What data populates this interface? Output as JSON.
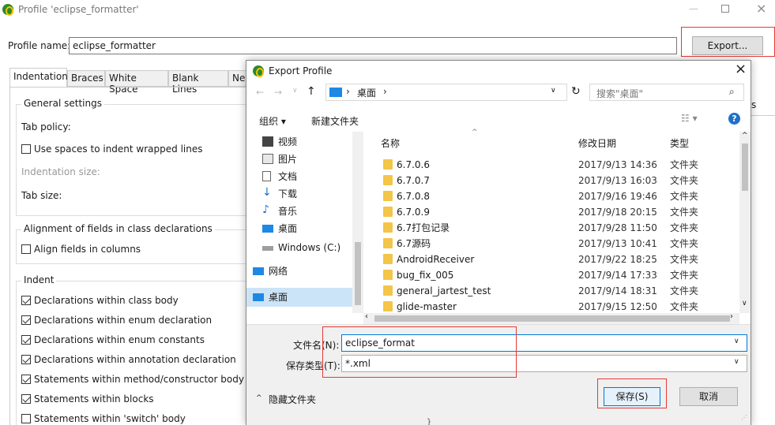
{
  "main_window": {
    "title": "Profile 'eclipse_formatter'",
    "profile_name_label": "Profile name:",
    "profile_name_value": "eclipse_formatter",
    "export_button": "Export...",
    "tabs": [
      "Indentation",
      "Braces",
      "White Space",
      "Blank Lines",
      "Ne"
    ],
    "right_edge_letter": "s",
    "preview_fragment": "}"
  },
  "groups": {
    "general": {
      "title": "General settings",
      "tab_policy": "Tab policy:",
      "use_spaces": "Use spaces to indent wrapped lines",
      "indentation_size": "Indentation size:",
      "tab_size": "Tab size:"
    },
    "alignment": {
      "title": "Alignment of fields in class declarations",
      "align_fields": "Align fields in columns"
    },
    "indent": {
      "title": "Indent",
      "items": [
        {
          "label": "Declarations within class body",
          "checked": true
        },
        {
          "label": "Declarations within enum declaration",
          "checked": true
        },
        {
          "label": "Declarations within enum constants",
          "checked": true
        },
        {
          "label": "Declarations within annotation declaration",
          "checked": true
        },
        {
          "label": "Statements within method/constructor body",
          "checked": true
        },
        {
          "label": "Statements within blocks",
          "checked": true
        },
        {
          "label": "Statements within 'switch' body",
          "checked": false
        }
      ]
    }
  },
  "dialog": {
    "title": "Export Profile",
    "close": "×",
    "path_current": "桌面",
    "path_sep": "›",
    "search_placeholder": "搜索\"桌面\"",
    "organize": "组织 ▾",
    "new_folder": "新建文件夹",
    "nav": [
      "视频",
      "图片",
      "文档",
      "下载",
      "音乐",
      "桌面",
      "Windows (C:)",
      "网络",
      "桌面"
    ],
    "columns": {
      "name": "名称",
      "date": "修改日期",
      "type": "类型"
    },
    "files": [
      {
        "name": "6.7.0.6",
        "date": "2017/9/13 14:36",
        "type": "文件夹"
      },
      {
        "name": "6.7.0.7",
        "date": "2017/9/13 16:03",
        "type": "文件夹"
      },
      {
        "name": "6.7.0.8",
        "date": "2017/9/16 19:46",
        "type": "文件夹"
      },
      {
        "name": "6.7.0.9",
        "date": "2017/9/18 20:15",
        "type": "文件夹"
      },
      {
        "name": "6.7打包记录",
        "date": "2017/9/28 11:50",
        "type": "文件夹"
      },
      {
        "name": "6.7源码",
        "date": "2017/9/13 10:41",
        "type": "文件夹"
      },
      {
        "name": "AndroidReceiver",
        "date": "2017/9/22 18:25",
        "type": "文件夹"
      },
      {
        "name": "bug_fix_005",
        "date": "2017/9/14 17:33",
        "type": "文件夹"
      },
      {
        "name": "general_jartest_test",
        "date": "2017/9/14 18:31",
        "type": "文件夹"
      },
      {
        "name": "glide-master",
        "date": "2017/9/15 12:50",
        "type": "文件夹"
      }
    ],
    "filename_label": "文件名(N):",
    "filename_value": "eclipse_format",
    "filetype_label": "保存类型(T):",
    "filetype_value": "*.xml",
    "hide_folders": "隐藏文件夹",
    "save": "保存(S)",
    "cancel": "取消"
  },
  "colors": {
    "accent": "#0078d7",
    "highlight": "#e53935",
    "folder": "#f3c548"
  }
}
